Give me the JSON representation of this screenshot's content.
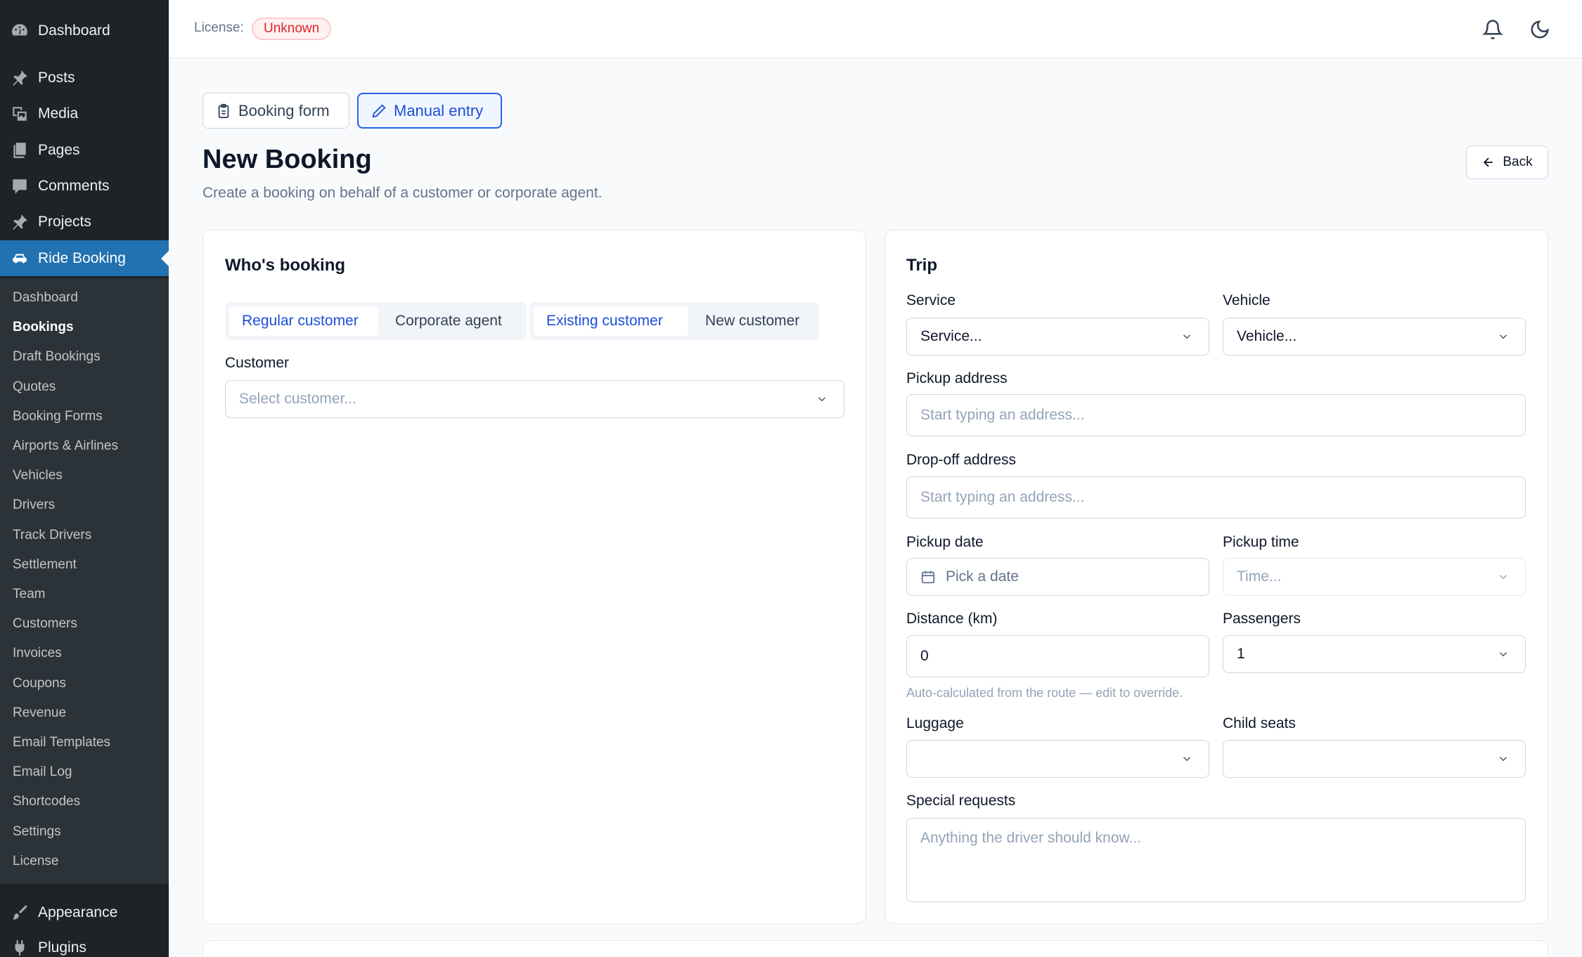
{
  "sidebar": {
    "top_items": [
      {
        "label": "Dashboard",
        "icon": "dashboard-icon"
      },
      {
        "label": "Posts",
        "icon": "pin-icon"
      },
      {
        "label": "Media",
        "icon": "media-icon"
      },
      {
        "label": "Pages",
        "icon": "pages-icon"
      },
      {
        "label": "Comments",
        "icon": "comment-icon"
      },
      {
        "label": "Projects",
        "icon": "pin-icon"
      },
      {
        "label": "Ride Booking",
        "icon": "car-icon"
      }
    ],
    "sub_items": [
      "Dashboard",
      "Bookings",
      "Draft Bookings",
      "Quotes",
      "Booking Forms",
      "Airports & Airlines",
      "Vehicles",
      "Drivers",
      "Track Drivers",
      "Settlement",
      "Team",
      "Customers",
      "Invoices",
      "Coupons",
      "Revenue",
      "Email Templates",
      "Email Log",
      "Shortcodes",
      "Settings",
      "License"
    ],
    "bottom_items": [
      {
        "label": "Appearance",
        "icon": "brush-icon"
      },
      {
        "label": "Plugins",
        "icon": "plug-icon"
      }
    ]
  },
  "topbar": {
    "license_label": "License:",
    "license_status": "Unknown"
  },
  "modes": {
    "booking_form": "Booking form",
    "manual_entry": "Manual entry"
  },
  "header": {
    "title": "New Booking",
    "subtitle": "Create a booking on behalf of a customer or corporate agent.",
    "back": "Back"
  },
  "who": {
    "title": "Who's booking",
    "type_regular": "Regular customer",
    "type_corporate": "Corporate agent",
    "existing": "Existing customer",
    "new": "New customer",
    "customer_label": "Customer",
    "customer_placeholder": "Select customer..."
  },
  "trip": {
    "title": "Trip",
    "service_label": "Service",
    "service_value": "Service...",
    "vehicle_label": "Vehicle",
    "vehicle_value": "Vehicle...",
    "pickup_label": "Pickup address",
    "pickup_placeholder": "Start typing an address...",
    "dropoff_label": "Drop-off address",
    "dropoff_placeholder": "Start typing an address...",
    "date_label": "Pickup date",
    "date_placeholder": "Pick a date",
    "time_label": "Pickup time",
    "time_placeholder": "Time...",
    "distance_label": "Distance (km)",
    "distance_value": "0",
    "distance_hint": "Auto-calculated from the route — edit to override.",
    "passengers_label": "Passengers",
    "passengers_value": "1",
    "luggage_label": "Luggage",
    "child_seats_label": "Child seats",
    "special_label": "Special requests",
    "special_placeholder": "Anything the driver should know..."
  }
}
